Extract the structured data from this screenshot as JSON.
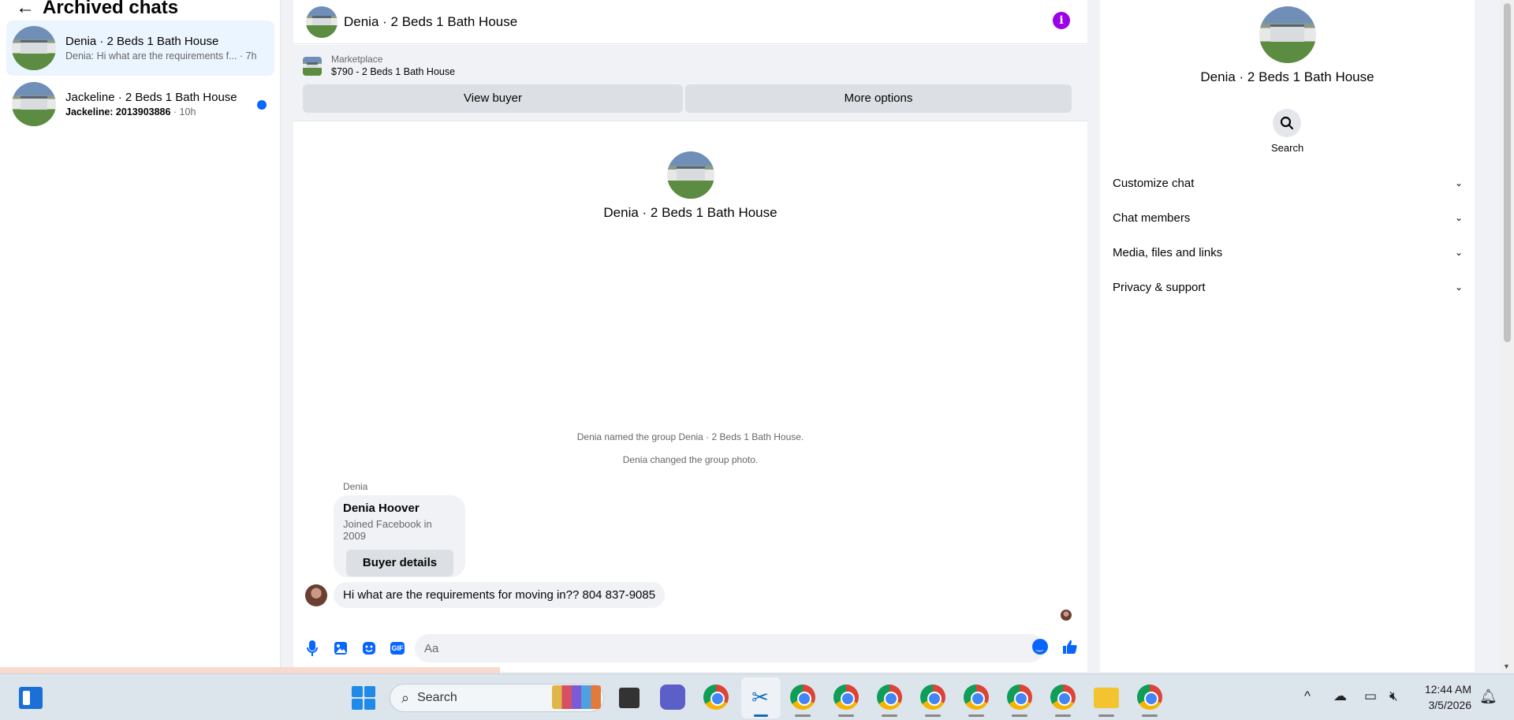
{
  "sidebar": {
    "header": {
      "title": "Archived chats",
      "back_icon": "←"
    },
    "chats": [
      {
        "name": "Denia · 2 Beds 1 Bath House",
        "preview": "Denia: Hi what are the requirements f...",
        "time": "· 7h",
        "active": true,
        "unread": false
      },
      {
        "name": "Jackeline · 2 Beds 1 Bath House",
        "preview": "Jackeline: 2013903886",
        "time": " · 10h",
        "active": false,
        "unread": true
      }
    ]
  },
  "conversation": {
    "title": "Denia · 2 Beds 1 Bath House",
    "info_icon": "i",
    "marketplace": {
      "label": "Marketplace",
      "listing": "$790 - 2 Beds 1 Bath House",
      "view_buyer": "View buyer",
      "more_options": "More options"
    },
    "intro_name": "Denia · 2 Beds 1 Bath House",
    "system_messages": [
      "Denia named the group Denia · 2 Beds 1 Bath House.",
      "Denia changed the group photo."
    ],
    "sender_label": "Denia",
    "buyer_card": {
      "name": "Denia Hoover",
      "subtitle": "Joined Facebook in 2009",
      "button": "Buyer details"
    },
    "message": "Hi what are the requirements for moving in?? 804 837-9085",
    "composer": {
      "placeholder": "Aa",
      "gif_label": "GIF"
    }
  },
  "details": {
    "name": "Denia · 2 Beds 1 Bath House",
    "search_label": "Search",
    "sections": [
      "Customize chat",
      "Chat members",
      "Media, files and links",
      "Privacy & support"
    ]
  },
  "taskbar": {
    "search_placeholder": "Search",
    "time": "12:44 AM",
    "date": "3/5/2026"
  },
  "colors": {
    "accent": "#0866ff",
    "info": "#9b00e8",
    "active_chat": "#ebf5ff"
  }
}
